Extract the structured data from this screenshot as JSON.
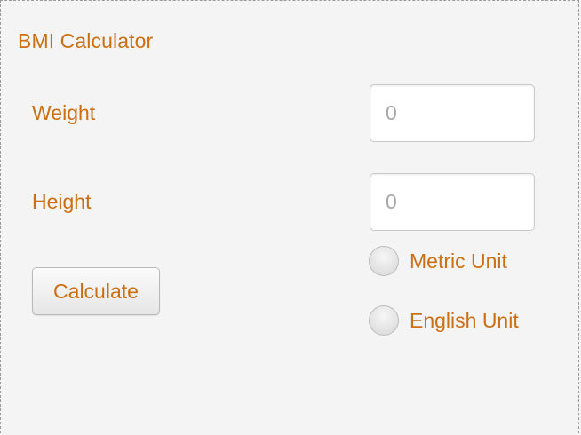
{
  "window": {
    "title": "BMI Calculator"
  },
  "form": {
    "weight_label": "Weight",
    "weight_value": "0",
    "height_label": "Height",
    "height_value": "0",
    "calculate_label": "Calculate",
    "units": [
      {
        "label": "Metric Unit",
        "selected": false
      },
      {
        "label": "English Unit",
        "selected": false
      }
    ]
  },
  "colors": {
    "accent_text": "#cc6f12",
    "background": "#f4f4f4",
    "field_text": "#a7a7a7"
  }
}
